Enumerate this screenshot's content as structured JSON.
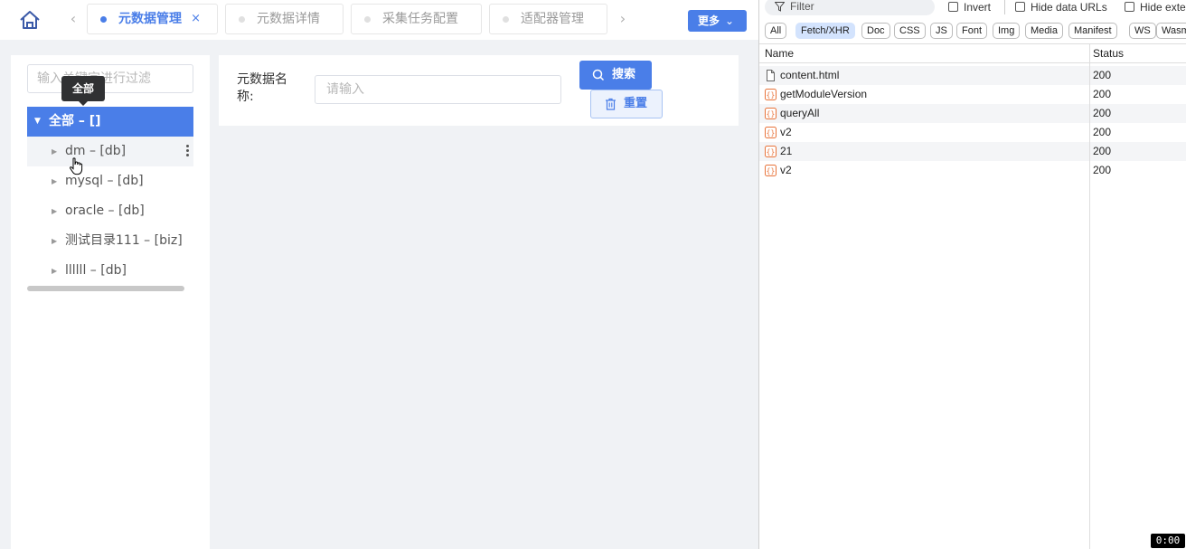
{
  "topbar": {
    "home_icon": "home-icon",
    "tabs": [
      {
        "label": "元数据管理",
        "close": "×",
        "active": true
      },
      {
        "label": "元数据详情",
        "active": false
      },
      {
        "label": "采集任务配置",
        "active": false
      },
      {
        "label": "适配器管理",
        "active": false
      }
    ],
    "prev_arrow": "‹",
    "next_arrow": "›",
    "more_label": "更多",
    "more_chevron": "⌄"
  },
  "sidebar": {
    "filter_placeholder": "输入关键字进行过滤",
    "tooltip": "全部",
    "root": {
      "caret": "▼",
      "label": "全部 – []"
    },
    "nodes": [
      {
        "caret": "▶",
        "label": "dm – [db]"
      },
      {
        "caret": "▶",
        "label": "mysql – [db]"
      },
      {
        "caret": "▶",
        "label": "oracle – [db]"
      },
      {
        "caret": "▶",
        "label": "测试目录111 – [biz]"
      },
      {
        "caret": "▶",
        "label": "llllll – [db]"
      }
    ]
  },
  "search": {
    "field_label": "元数据名称:",
    "input_placeholder": "请输入",
    "search_label": "搜索",
    "reset_label": "重置"
  },
  "devtools": {
    "filter_placeholder": "Filter",
    "invert_label": "Invert",
    "hide_data_urls_label": "Hide data URLs",
    "hide_ext_label": "Hide exte",
    "chips": [
      "All",
      "Fetch/XHR",
      "Doc",
      "CSS",
      "JS",
      "Font",
      "Img",
      "Media",
      "Manifest",
      "WS",
      "Wasm"
    ],
    "active_chip": "Fetch/XHR",
    "columns": {
      "name": "Name",
      "status": "Status"
    },
    "rows": [
      {
        "name": "content.html",
        "status": "200",
        "icon": "document-icon"
      },
      {
        "name": "getModuleVersion",
        "status": "200",
        "icon": "xhr-icon"
      },
      {
        "name": "queryAll",
        "status": "200",
        "icon": "xhr-icon"
      },
      {
        "name": "v2",
        "status": "200",
        "icon": "xhr-icon"
      },
      {
        "name": "21",
        "status": "200",
        "icon": "xhr-icon"
      },
      {
        "name": "v2",
        "status": "200",
        "icon": "xhr-icon"
      }
    ]
  },
  "timer": "0:00",
  "colors": {
    "accent": "#4a7ee8",
    "xhr_icon": "#e8743b",
    "active_chip_bg": "#d3e3fd"
  }
}
